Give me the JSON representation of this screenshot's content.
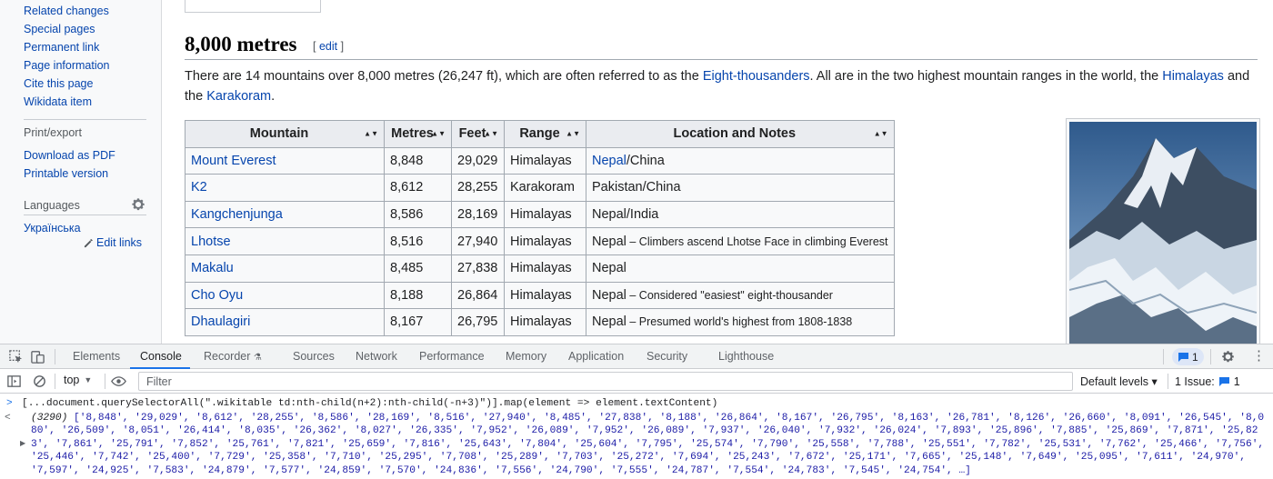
{
  "sidebar": {
    "tools_links": [
      "Related changes",
      "Special pages",
      "Permanent link",
      "Page information",
      "Cite this page",
      "Wikidata item"
    ],
    "print_heading": "Print/export",
    "print_links": [
      "Download as PDF",
      "Printable version"
    ],
    "languages_heading": "Languages",
    "language_links": [
      "Українська"
    ],
    "edit_links_label": "Edit links"
  },
  "section": {
    "title": "8,000 metres",
    "edit_open": "[ ",
    "edit_label": "edit",
    "edit_close": " ]",
    "intro_before_link1": "There are 14 mountains over 8,000 metres (26,247 ft), which are often referred to as the ",
    "intro_link1": "Eight-thousanders",
    "intro_between": ". All are in the two highest mountain ranges in the world, the ",
    "intro_link2": "Himalayas",
    "intro_and": " and the ",
    "intro_link3": "Karakoram",
    "intro_end": "."
  },
  "table": {
    "headers": [
      "Mountain",
      "Metres",
      "Feet",
      "Range",
      "Location and Notes"
    ],
    "sort_glyph": "▲▼",
    "rows": [
      {
        "mountain": "Mount Everest",
        "metres": "8,848",
        "feet": "29,029",
        "range": "Himalayas",
        "loc_link": "Nepal",
        "loc_rest": "/China",
        "note": ""
      },
      {
        "mountain": "K2",
        "metres": "8,612",
        "feet": "28,255",
        "range": "Karakoram",
        "loc_link": "",
        "loc_rest": "Pakistan/China",
        "note": ""
      },
      {
        "mountain": "Kangchenjunga",
        "metres": "8,586",
        "feet": "28,169",
        "range": "Himalayas",
        "loc_link": "",
        "loc_rest": "Nepal/India",
        "note": ""
      },
      {
        "mountain": "Lhotse",
        "metres": "8,516",
        "feet": "27,940",
        "range": "Himalayas",
        "loc_link": "",
        "loc_rest": "Nepal",
        "note": " – Climbers ascend Lhotse Face in climbing Everest"
      },
      {
        "mountain": "Makalu",
        "metres": "8,485",
        "feet": "27,838",
        "range": "Himalayas",
        "loc_link": "",
        "loc_rest": "Nepal",
        "note": ""
      },
      {
        "mountain": "Cho Oyu",
        "metres": "8,188",
        "feet": "26,864",
        "range": "Himalayas",
        "loc_link": "",
        "loc_rest": "Nepal",
        "note": " – Considered \"easiest\" eight-thousander"
      },
      {
        "mountain": "Dhaulagiri",
        "metres": "8,167",
        "feet": "26,795",
        "range": "Himalayas",
        "loc_link": "",
        "loc_rest": "Nepal",
        "note": " – Presumed world's highest from 1808-1838"
      }
    ]
  },
  "devtools": {
    "tabs": [
      "Elements",
      "Console",
      "Recorder",
      "Sources",
      "Network",
      "Performance",
      "Memory",
      "Application",
      "Security",
      "Lighthouse"
    ],
    "active_tab": "Console",
    "message_count": "1",
    "context": "top",
    "filter_placeholder": "Filter",
    "levels_label": "Default levels ▾",
    "issues_label": "1 Issue:",
    "issues_count": "1",
    "prompt_symbol": ">",
    "command": "[...document.querySelectorAll(\".wikitable td:nth-child(n+2):nth-child(-n+3)\")].map(element => element.textContent)",
    "result_arrow": "<",
    "result_expand": "▶",
    "result_count": "(3290) ",
    "result_body": "['8,848', '29,029', '8,612', '28,255', '8,586', '28,169', '8,516', '27,940', '8,485', '27,838', '8,188', '26,864', '8,167', '26,795', '8,163', '26,781', '8,126', '26,660', '8,091', '26,545', '8,080', '26,509', '8,051', '26,414', '8,035', '26,362', '8,027', '26,335', '7,952', '26,089', '7,952', '26,089', '7,937', '26,040', '7,932', '26,024', '7,893', '25,896', '7,885', '25,869', '7,871', '25,823', '7,861', '25,791', '7,852', '25,761', '7,821', '25,659', '7,816', '25,643', '7,804', '25,604', '7,795', '25,574', '7,790', '25,558', '7,788', '25,551', '7,782', '25,531', '7,762', '25,466', '7,756', '25,446', '7,742', '25,400', '7,729', '25,358', '7,710', '25,295', '7,708', '25,289', '7,703', '25,272', '7,694', '25,243', '7,672', '25,171', '7,665', '25,148', '7,649', '25,095', '7,611', '24,970', '7,597', '24,925', '7,583', '24,879', '7,577', '24,859', '7,570', '24,836', '7,556', '24,790', '7,555', '24,787', '7,554', '24,783', '7,545', '24,754', …]"
  },
  "colors": {
    "link": "#0645ad",
    "devtools_accent": "#1a73e8",
    "console_string": "#1a1aa6"
  },
  "icons": [
    "gear-icon",
    "pencil-icon",
    "inspect-icon",
    "device-toggle-icon",
    "sidebar-toggle-icon",
    "clear-console-icon",
    "eye-icon",
    "message-icon",
    "settings-icon",
    "more-icon"
  ]
}
